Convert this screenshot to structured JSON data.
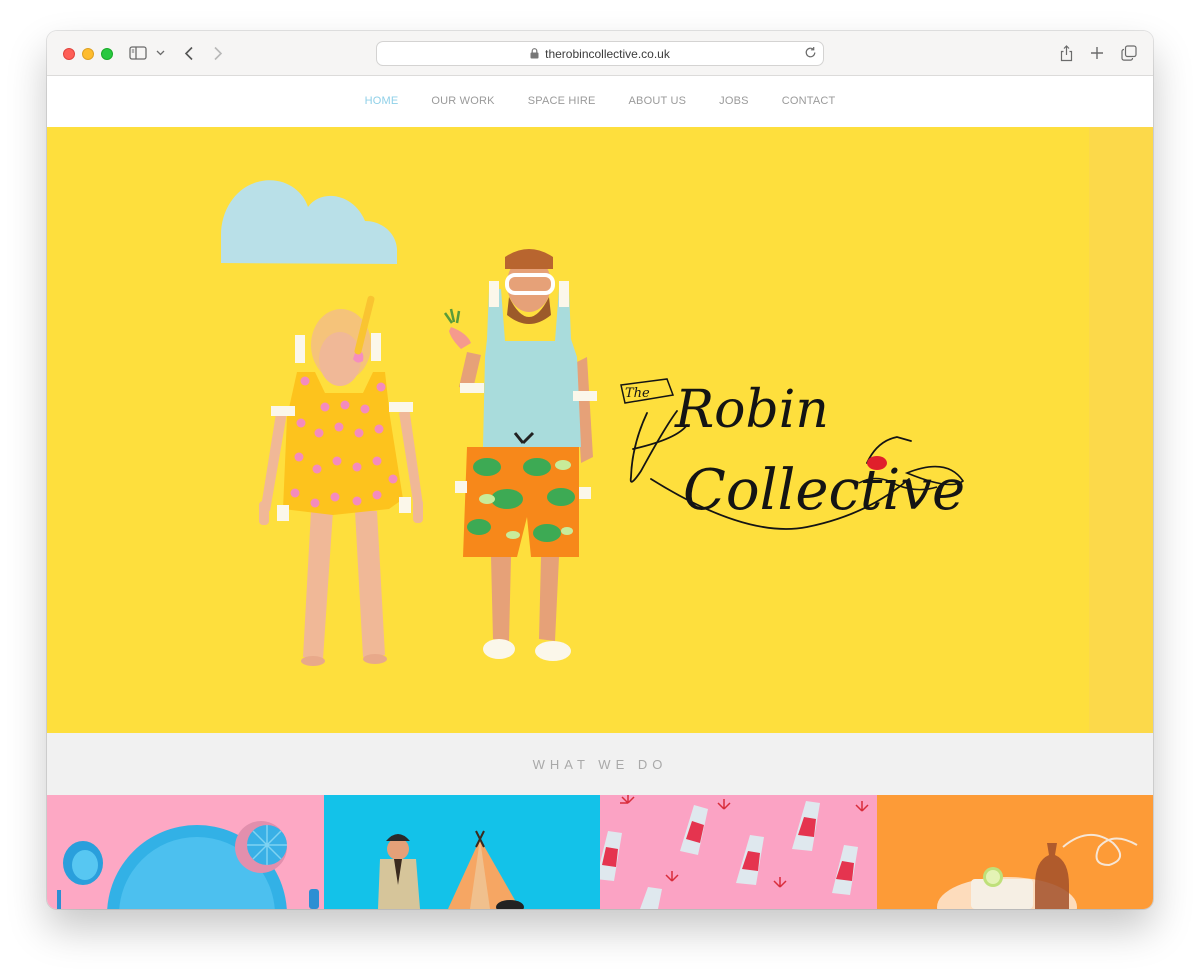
{
  "browser": {
    "url": "therobincollective.co.uk",
    "icons": [
      "sidebar-icon",
      "chevron-down-icon",
      "back-icon",
      "forward-icon",
      "lock-icon",
      "reload-icon",
      "share-icon",
      "new-tab-icon",
      "tabs-overview-icon"
    ]
  },
  "nav": {
    "items": [
      {
        "label": "HOME",
        "active": true
      },
      {
        "label": "OUR WORK",
        "active": false
      },
      {
        "label": "SPACE HIRE",
        "active": false
      },
      {
        "label": "ABOUT US",
        "active": false
      },
      {
        "label": "JOBS",
        "active": false
      },
      {
        "label": "CONTACT",
        "active": false
      }
    ]
  },
  "hero": {
    "logo_text_small": "The",
    "logo_text_line1": "Robin",
    "logo_text_line2": "Collective"
  },
  "section": {
    "title": "WHAT WE DO"
  },
  "tiles": [
    {
      "name": "tableware",
      "background": "#fda8c4"
    },
    {
      "name": "camping",
      "background": "#13c2e9"
    },
    {
      "name": "party-bottles",
      "background": "#fba3c4"
    },
    {
      "name": "cocktail",
      "background": "#fd9b37"
    }
  ],
  "colors": {
    "hero_background": "#fedf3d",
    "nav_active": "#8fd0e8",
    "nav_text": "#9a9a9a"
  }
}
